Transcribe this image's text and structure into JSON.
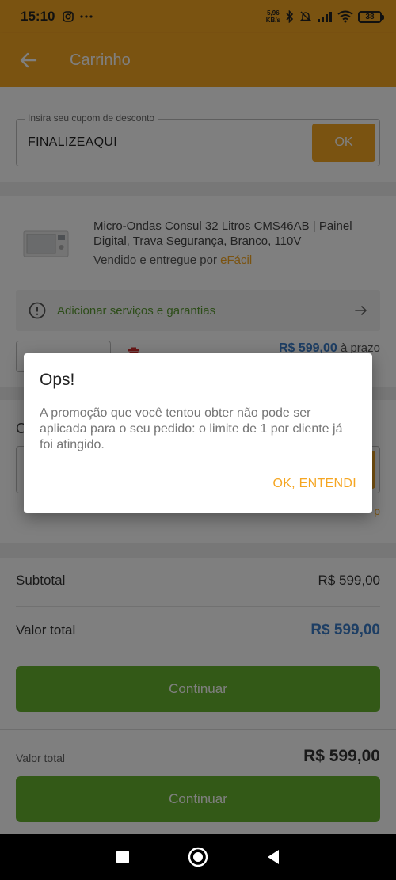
{
  "status_bar": {
    "time": "15:10",
    "net_speed_value": "5,96",
    "net_speed_unit": "KB/s",
    "battery": "38"
  },
  "app_bar": {
    "title": "Carrinho"
  },
  "coupon": {
    "label": "Insira seu cupom de desconto",
    "value": "FINALIZEAQUI",
    "button": "OK"
  },
  "product": {
    "name": "Micro-Ondas Consul 32 Litros CMS46AB | Painel Digital, Trava Segurança, Branco, 110V",
    "sold_by": "Vendido e entregue por",
    "seller": "eFácil",
    "services": "Adicionar serviços e garantias",
    "price": "R$ 599,00",
    "price_suffix": "à prazo"
  },
  "shipping": {
    "partial_letter": "C",
    "partial_link": "p"
  },
  "summary": {
    "subtotal_label": "Subtotal",
    "subtotal_value": "R$ 599,00",
    "total_label": "Valor total",
    "total_value": "R$ 599,00",
    "continue_label": "Continuar"
  },
  "bottom_bar": {
    "total_label": "Valor total",
    "total_value": "R$ 599,00",
    "continue_label": "Continuar"
  },
  "dialog": {
    "title": "Ops!",
    "message": "A promoção que você tentou obter não pode ser aplicada para o seu pedido: o limite de 1 por cliente já foi atingido.",
    "action": "OK, ENTENDI"
  },
  "colors": {
    "brand": "#f5a623",
    "success": "#66b32e",
    "price": "#3a7cc8"
  }
}
